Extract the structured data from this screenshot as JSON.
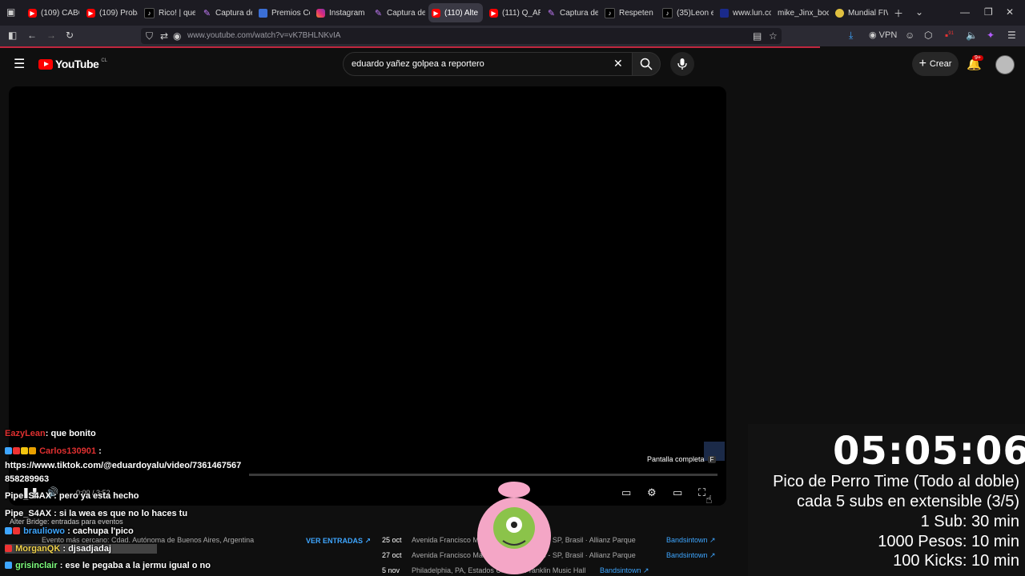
{
  "browser": {
    "tabs": [
      {
        "label": "(109) CABO",
        "icon": "yt"
      },
      {
        "label": "(109) Proba",
        "icon": "yt"
      },
      {
        "label": "Rico! | que r",
        "icon": "tt"
      },
      {
        "label": "Captura de",
        "icon": "cap"
      },
      {
        "label": "Premios Cor",
        "icon": "doc"
      },
      {
        "label": "Instagram",
        "icon": "ig"
      },
      {
        "label": "Captura de",
        "icon": "cap"
      },
      {
        "label": "(110) Alte",
        "icon": "yt",
        "active": true
      },
      {
        "label": "(111) Q_AR",
        "icon": "yt"
      },
      {
        "label": "Captura de",
        "icon": "cap"
      },
      {
        "label": "Respeten lo",
        "icon": "tt"
      },
      {
        "label": "(35)Leon en",
        "icon": "tt"
      },
      {
        "label": "www.lun.co",
        "icon": "lun"
      },
      {
        "label": "mike_Jinx_boca",
        "icon": "none"
      },
      {
        "label": "Mundial FIV",
        "icon": "ball"
      }
    ],
    "url": "www.youtube.com/watch?v=vK7BHLNKvIA",
    "vpn_label": "VPN",
    "ext_badge": "91"
  },
  "youtube": {
    "logo_text": "YouTube",
    "region": "CL",
    "search_value": "eduardo yañez golpea a reportero",
    "create_label": "Crear",
    "notif_count": "9+"
  },
  "player": {
    "fullscreen_tooltip": "Pantalla completa",
    "fullscreen_key": "F",
    "time": "0:00 / 3:52"
  },
  "events": {
    "artist_line": "Alter Bridge: entradas para eventos",
    "nearby": "Evento más cercano: Cdad. Autónoma de Buenos Aires, Argentina",
    "see_tickets": "VER ENTRADAS",
    "rows": [
      {
        "date": "25 oct",
        "venue": "Avenida Francisco Matarazzo · São Paulo - SP, Brasil · Allianz Parque",
        "source": "Bandsintown"
      },
      {
        "date": "27 oct",
        "venue": "Avenida Francisco Matarazzo · São Paulo - SP, Brasil · Allianz Parque",
        "source": "Bandsintown"
      },
      {
        "date": "5 nov",
        "venue": "Philadelphia, PA, Estados Unidos · Franklin Music Hall",
        "source": "Bandsintown"
      }
    ]
  },
  "chat": [
    {
      "user": "EazyLean",
      "text": ": que bonito"
    },
    {
      "user": "Carlos130901",
      "text": " :"
    },
    {
      "user": "",
      "text": "https://www.tiktok.com/@eduardoyalu/video/7361467567"
    },
    {
      "user": "",
      "text": "858289963"
    },
    {
      "user": "Pipe_S4AX",
      "text": " : pero ya esta hecho"
    },
    {
      "user": "Pipe_S4AX",
      "text": " : si la wea es que no lo haces tu"
    },
    {
      "user": "brauliowo",
      "text": " : cachupa l'pico"
    },
    {
      "user": "MorganQK",
      "text": " : djsadjadaj"
    },
    {
      "user": "grisinclair",
      "text": " : ese le pegaba a la jermu igual o no"
    }
  ],
  "stream_overlay": {
    "clock": "05:05:06",
    "lines": [
      "Pico de Perro Time (Todo al doble)",
      "cada 5 subs en extensible (3/5)",
      "1 Sub: 30 min",
      "1000 Pesos: 10 min",
      "100 Kicks: 10 min"
    ]
  }
}
